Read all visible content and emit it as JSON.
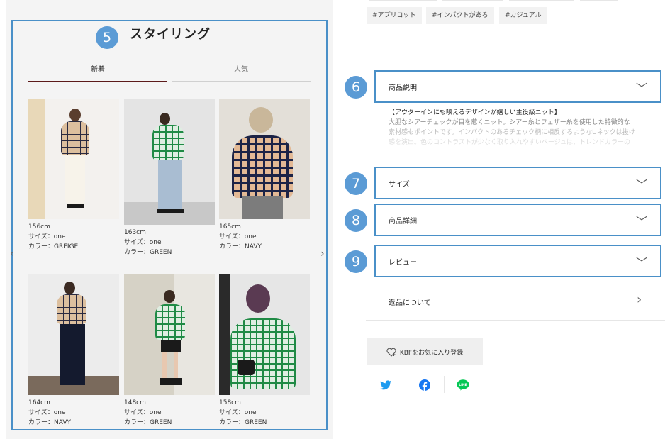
{
  "styling": {
    "badge": "5",
    "title": "スタイリング",
    "tabs": [
      {
        "label": "新着",
        "active": true
      },
      {
        "label": "人気",
        "active": false
      }
    ],
    "prev_icon": "‹",
    "next_icon": "›",
    "cards": [
      {
        "height": "156cm",
        "size": "サイズ：one",
        "color": "カラー：GREIGE"
      },
      {
        "height": "163cm",
        "size": "サイズ：one",
        "color": "カラー：GREEN"
      },
      {
        "height": "165cm",
        "size": "サイズ：one",
        "color": "カラー：NAVY"
      },
      {
        "height": "164cm",
        "size": "サイズ：one",
        "color": "カラー：NAVY"
      },
      {
        "height": "148cm",
        "size": "サイズ：one",
        "color": "カラー：GREEN"
      },
      {
        "height": "158cm",
        "size": "サイズ：one",
        "color": "カラー：GREEN"
      }
    ]
  },
  "tags": [
    "#アプリコット",
    "#インパクトがある",
    "#カジュアル"
  ],
  "accordion": [
    {
      "badge": "6",
      "label": "商品説明",
      "chevron": "﹀"
    },
    {
      "badge": "7",
      "label": "サイズ",
      "chevron": "﹀"
    },
    {
      "badge": "8",
      "label": "商品詳細",
      "chevron": "﹀"
    },
    {
      "badge": "9",
      "label": "レビュー",
      "chevron": "﹀"
    }
  ],
  "description": {
    "title": "【アウターインにも映えるデザインが嬉しい主役級ニット】",
    "line1": "大胆なシアーチェックが目を惹くニット。シアー糸とフェザー糸を使用した特徴的な",
    "line2": "素材感もポイントです。インパクトのあるチェック柄に相反するようなUネックは抜け",
    "line3": "感を演出。色のコントラストが少なく取り入れやすいベージュは、トレンドカラーの"
  },
  "returns": {
    "label": "返品について",
    "chevron": "›"
  },
  "favorite": {
    "label": "KBFをお気に入り登録",
    "icon": "heart-plus-icon"
  },
  "social": [
    {
      "name": "twitter",
      "color": "#1d9bf0"
    },
    {
      "name": "facebook",
      "color": "#1877f2"
    },
    {
      "name": "line",
      "color": "#06c755",
      "text": "LINE"
    }
  ],
  "colors": {
    "accent_blue": "#4a90c8",
    "badge_blue": "#5b9bd5",
    "tab_active": "#5c1a1a"
  }
}
